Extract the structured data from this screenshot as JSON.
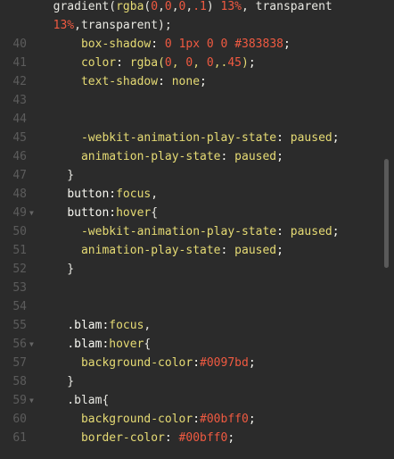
{
  "editor": {
    "lines": [
      {
        "n": "",
        "text": "  gradient(rgba(0,0,0,.1) 13%, transparent"
      },
      {
        "n": "",
        "text": "  13%,transparent);"
      },
      {
        "n": "40",
        "text": "      box-shadow: 0 1px 0 0 #383838;"
      },
      {
        "n": "41",
        "text": "      color: rgba(0, 0, 0,.45);"
      },
      {
        "n": "42",
        "text": "      text-shadow: none;"
      },
      {
        "n": "43",
        "text": ""
      },
      {
        "n": "44",
        "text": ""
      },
      {
        "n": "45",
        "text": "      -webkit-animation-play-state: paused;"
      },
      {
        "n": "46",
        "text": "      animation-play-state: paused;"
      },
      {
        "n": "47",
        "text": "    }"
      },
      {
        "n": "48",
        "text": "    button:focus,"
      },
      {
        "n": "49",
        "text": "    button:hover{"
      },
      {
        "n": "50",
        "text": "      -webkit-animation-play-state: paused;"
      },
      {
        "n": "51",
        "text": "      animation-play-state: paused;"
      },
      {
        "n": "52",
        "text": "    }"
      },
      {
        "n": "53",
        "text": ""
      },
      {
        "n": "54",
        "text": ""
      },
      {
        "n": "55",
        "text": "    .blam:focus,"
      },
      {
        "n": "56",
        "text": "    .blam:hover{"
      },
      {
        "n": "57",
        "text": "      background-color:#0097bd;"
      },
      {
        "n": "58",
        "text": "    }"
      },
      {
        "n": "59",
        "text": "    .blam{"
      },
      {
        "n": "60",
        "text": "      background-color:#00bff0;"
      },
      {
        "n": "61",
        "text": "      border-color: #00bff0;"
      }
    ],
    "fold_markers": {
      "49": "▼",
      "56": "▼",
      "59": "▼"
    },
    "colors": {
      "background": "#2b2b2b",
      "line_number": "#5c5c5c",
      "selector": "#f8f8f2",
      "property": "#e6db74",
      "number": "#f05a41"
    }
  }
}
